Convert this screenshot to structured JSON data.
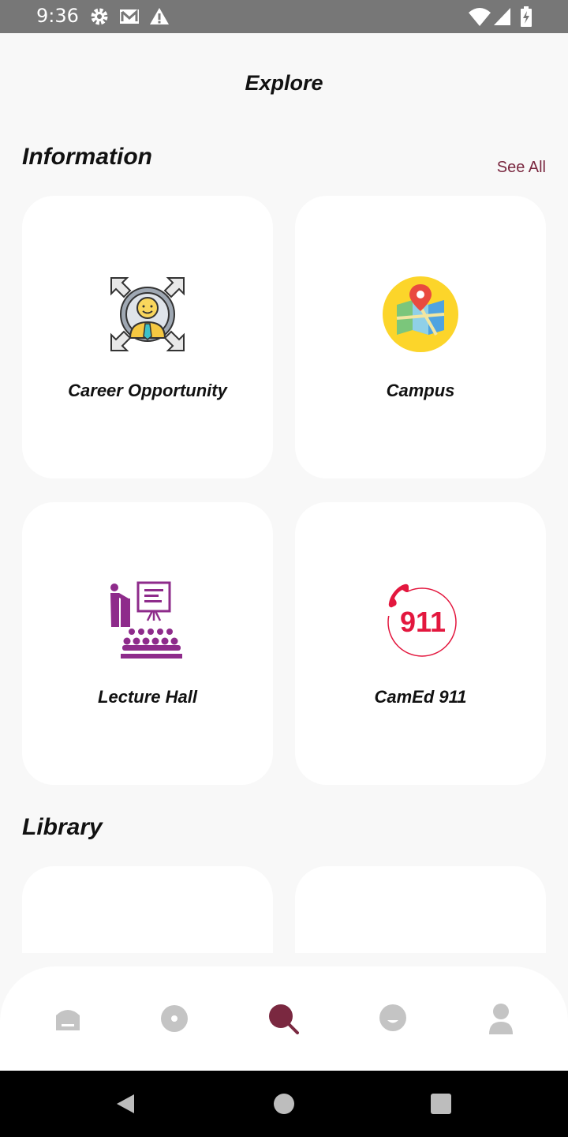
{
  "status_bar": {
    "time": "9:36"
  },
  "header": {
    "title": "Explore"
  },
  "information": {
    "heading": "Information",
    "see_all": "See All",
    "cards": [
      {
        "label": "Career Opportunity",
        "icon": "career-person-icon"
      },
      {
        "label": "Campus",
        "icon": "campus-map-icon"
      },
      {
        "label": "Lecture Hall",
        "icon": "lecture-hall-icon"
      },
      {
        "label": "CamEd 911",
        "icon": "emergency-911-icon",
        "icon_text": "911"
      }
    ]
  },
  "library": {
    "heading": "Library"
  },
  "bottom_nav": {
    "items": [
      {
        "name": "home",
        "icon": "home-icon"
      },
      {
        "name": "record",
        "icon": "circle-icon"
      },
      {
        "name": "explore",
        "icon": "search-icon",
        "active": true
      },
      {
        "name": "chat",
        "icon": "chat-icon"
      },
      {
        "name": "profile",
        "icon": "person-icon"
      }
    ],
    "active_color": "#7a2840",
    "inactive_color": "#c4c4c4"
  },
  "colors": {
    "accent": "#7a2840",
    "background": "#f8f8f8"
  }
}
